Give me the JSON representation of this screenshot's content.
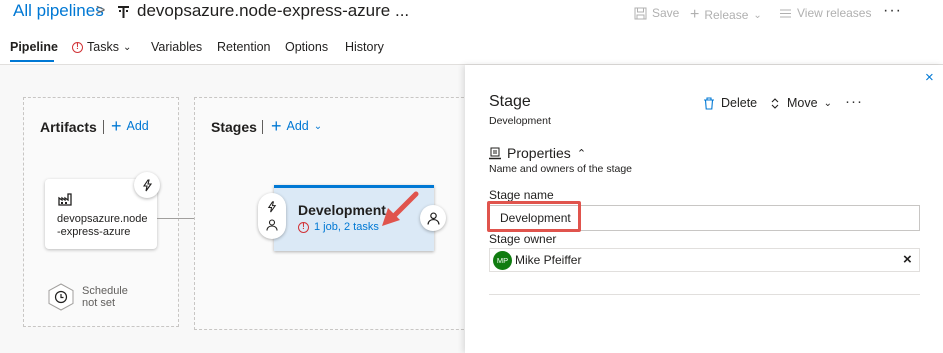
{
  "header": {
    "breadcrumb": "All pipelines",
    "breadcrumb_separator": ">",
    "pipeline_title": "devopsazure.node-express-azure ...",
    "toolbar": {
      "save_label": "Save",
      "release_label": "Release",
      "view_releases_label": "View releases",
      "more_label": "···"
    }
  },
  "tabs": [
    {
      "label": "Pipeline",
      "active": true
    },
    {
      "label": "Tasks",
      "warning": true
    },
    {
      "label": "Variables"
    },
    {
      "label": "Retention"
    },
    {
      "label": "Options"
    },
    {
      "label": "History"
    }
  ],
  "canvas": {
    "artifacts": {
      "title": "Artifacts",
      "add_label": "Add",
      "card_name": "devopsazure.node-express-azure",
      "schedule_text_line1": "Schedule",
      "schedule_text_line2": "not set"
    },
    "stages": {
      "title": "Stages",
      "add_label": "Add",
      "stage_name": "Development",
      "stage_summary": "1 job, 2 tasks"
    }
  },
  "panel": {
    "title": "Stage",
    "subtitle": "Development",
    "delete_label": "Delete",
    "move_label": "Move",
    "more_label": "···",
    "properties_heading": "Properties",
    "properties_desc": "Name and owners of the stage",
    "stage_name_label": "Stage name",
    "stage_name_value": "Development",
    "stage_owner_label": "Stage owner",
    "owner_initials": "MP",
    "owner_name": "Mike Pfeiffer",
    "close_label": "×",
    "clear_label": "×"
  },
  "colors": {
    "accent": "#0078d4",
    "warning": "#d13438",
    "highlight": "#e0544d",
    "stage_card_bg": "#dbe9f6",
    "owner_avatar_bg": "#107c10"
  },
  "icons": [
    "pipeline-icon",
    "save-icon",
    "plus-icon",
    "chevron-down-icon",
    "list-icon",
    "warning-icon",
    "trigger-icon",
    "build-artifact-icon",
    "clock-icon",
    "person-icon",
    "trash-icon",
    "updown-icon",
    "properties-icon",
    "chevron-up-icon",
    "close-icon"
  ]
}
